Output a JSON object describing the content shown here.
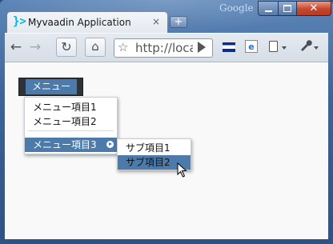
{
  "window": {
    "google_label": "Google",
    "minimize_icon": "minimize-icon",
    "maximize_icon": "maximize-icon",
    "close_glyph": "✕"
  },
  "tab": {
    "logo_glyph": "}>",
    "title": "Myvaadin Application",
    "close_glyph": "×",
    "new_tab_glyph": "+"
  },
  "toolbar": {
    "back_glyph": "←",
    "forward_glyph": "→",
    "reload_glyph": "↻",
    "home_glyph": "⌂",
    "star_glyph": "☆",
    "url": "http://localhost",
    "wrench_glyph": "🔧",
    "ie_glyph": "e"
  },
  "menubar": {
    "item_label": "メニュー"
  },
  "menu": {
    "items": [
      {
        "label": "メニュー項目1"
      },
      {
        "label": "メニュー項目2"
      },
      {
        "label": "メニュー項目3",
        "selected": true,
        "has_submenu": true
      }
    ]
  },
  "submenu": {
    "items": [
      {
        "label": "サブ項目1"
      },
      {
        "label": "サブ項目2",
        "selected": true
      }
    ]
  },
  "colors": {
    "selection": "#4b7aab",
    "menubar": "#2e3338",
    "frame": "#3d6498"
  }
}
